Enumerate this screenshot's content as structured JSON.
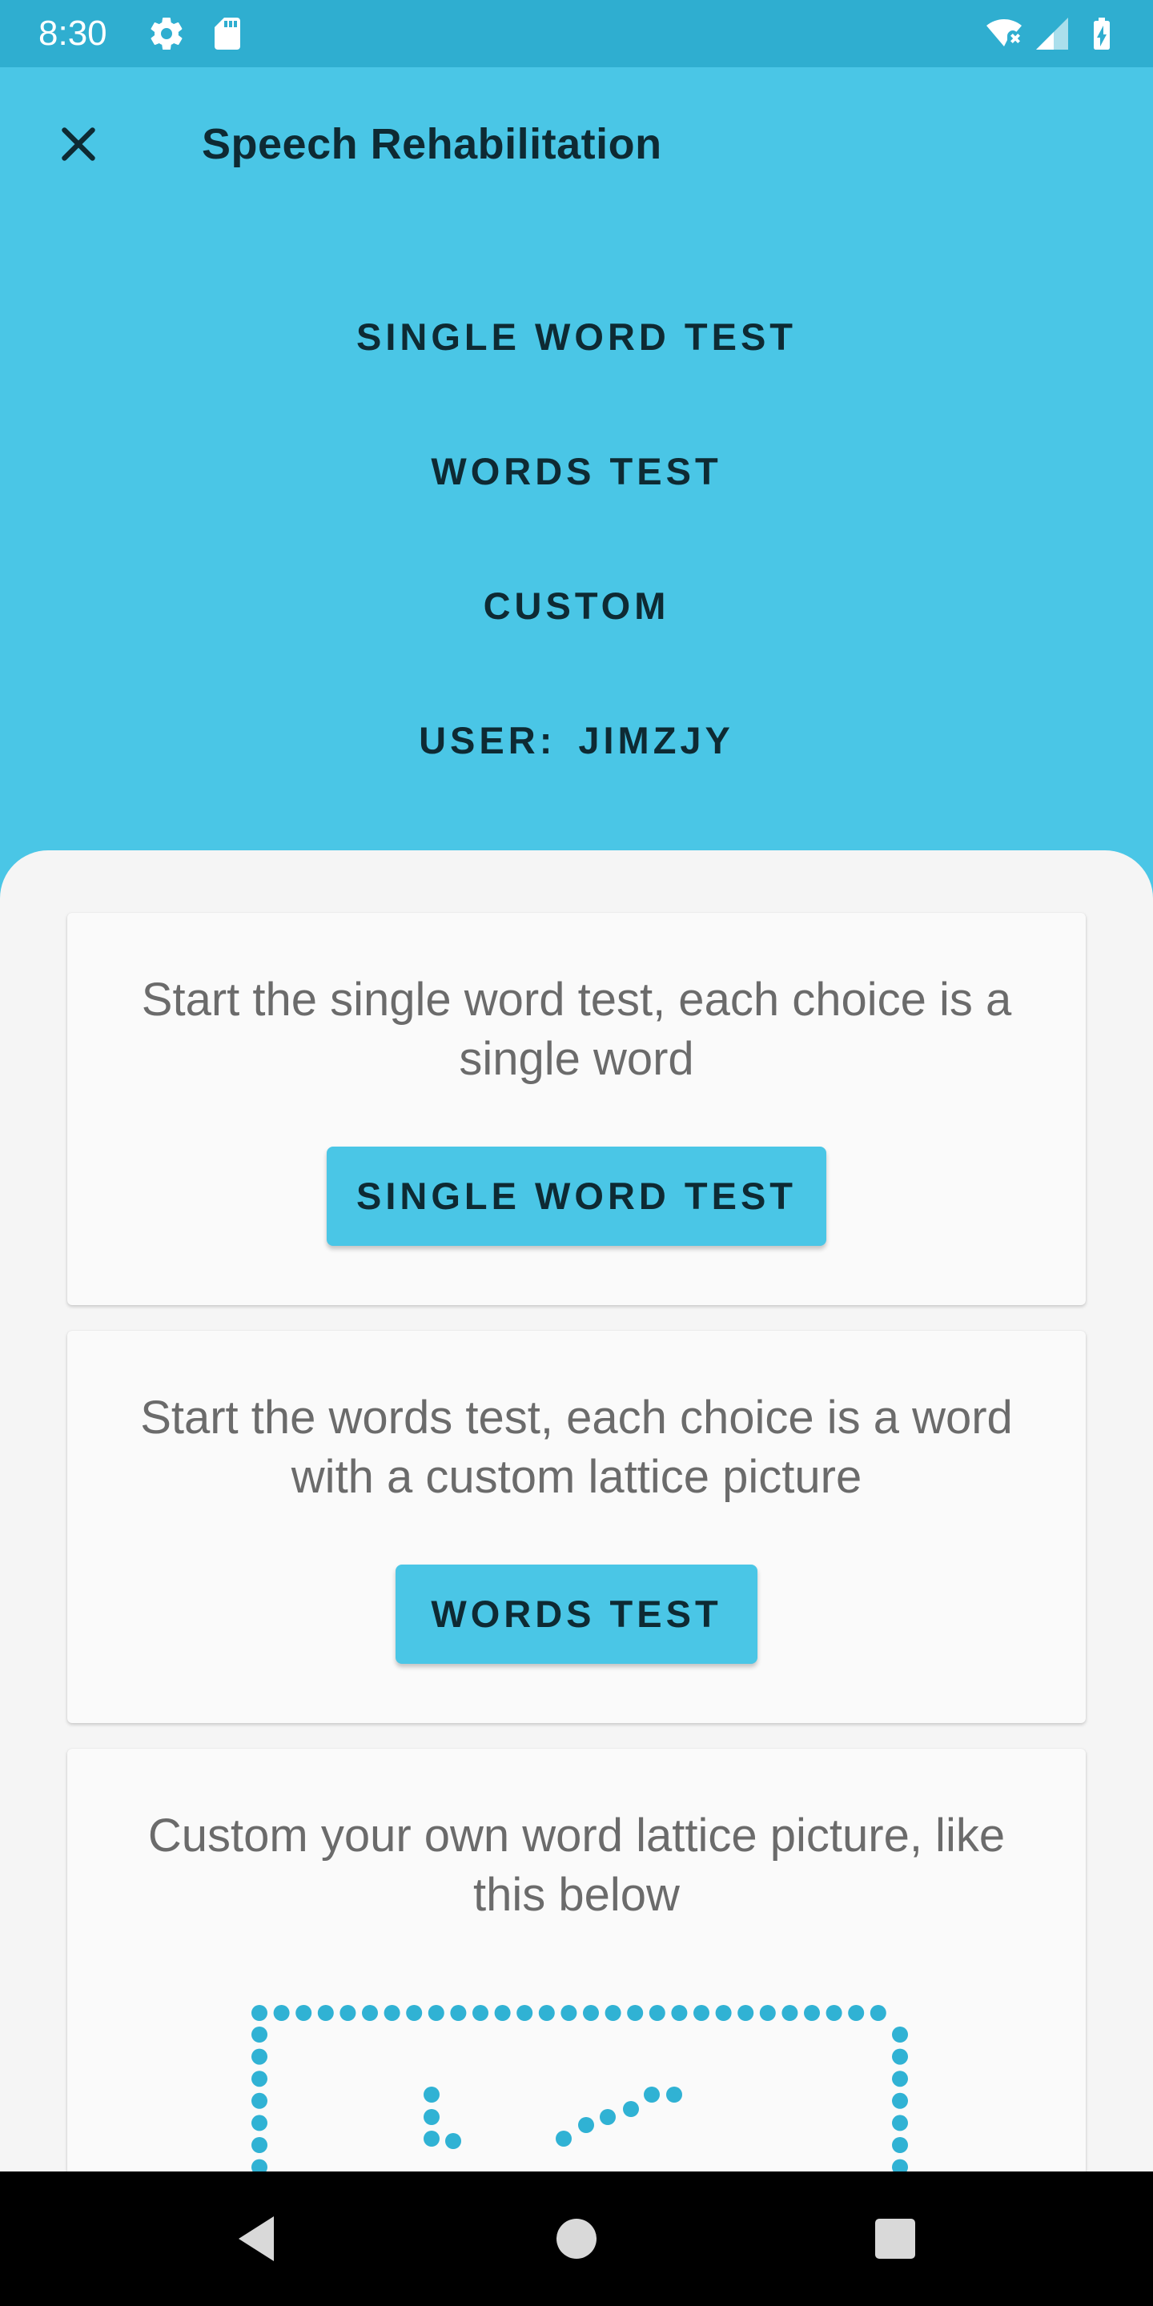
{
  "status_bar": {
    "time": "8:30",
    "icons": [
      "gear-icon",
      "sd-card-icon",
      "wifi-off-icon",
      "signal-icon",
      "battery-charging-icon"
    ],
    "color": "#2FAED0"
  },
  "header": {
    "close_icon": "close-icon",
    "title": "Speech Rehabilitation",
    "color": "#4AC6E6"
  },
  "hero_menu": {
    "single_word_test": "SINGLE WORD TEST",
    "words_test": "WORDS TEST",
    "custom": "CUSTOM",
    "user_label": "USER:",
    "user_value": "JIMZJY"
  },
  "cards": [
    {
      "description": "Start the single word test, each choice is a single word",
      "button_label": "SINGLE WORD TEST"
    },
    {
      "description": "Start the words test, each choice is a word with a custom lattice picture",
      "button_label": "WORDS TEST"
    },
    {
      "description": "Custom your own word lattice picture, like this below",
      "image": "word-lattice-picture"
    }
  ],
  "nav_bar": {
    "icons": [
      "back-icon",
      "home-icon",
      "recents-icon"
    ]
  },
  "colors": {
    "accent": "#4AC6E6",
    "status": "#2FAED0",
    "text_dark": "#0E2A33",
    "text_muted": "#6B6B6B",
    "dot": "#30B2D4"
  }
}
